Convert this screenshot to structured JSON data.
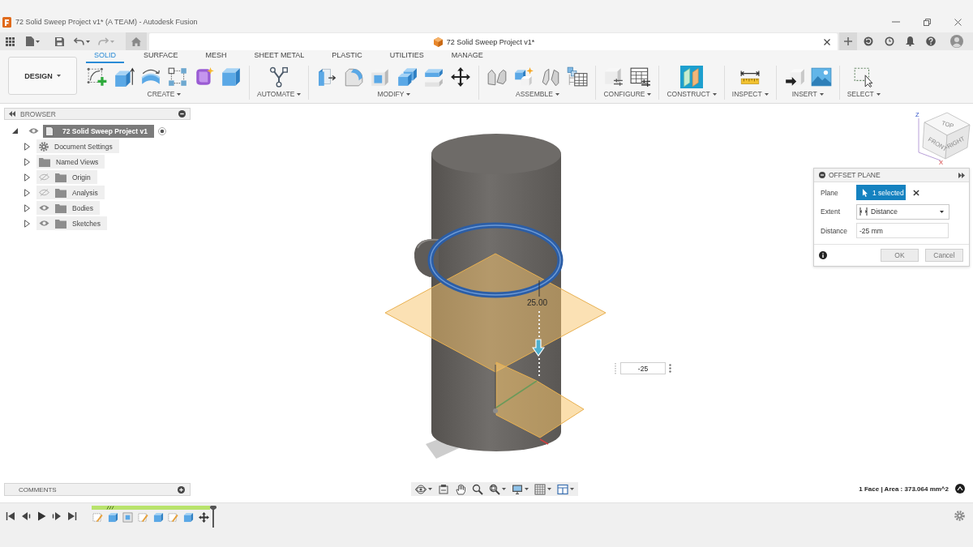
{
  "window": {
    "title": "72 Solid Sweep Project v1* (A TEAM) - Autodesk Fusion"
  },
  "document_tab": {
    "title": "72 Solid Sweep Project v1*"
  },
  "ribbon": {
    "workspace": "DESIGN",
    "tabs": [
      {
        "label": "SOLID",
        "selected": true
      },
      {
        "label": "SURFACE",
        "selected": false
      },
      {
        "label": "MESH",
        "selected": false
      },
      {
        "label": "SHEET METAL",
        "selected": false
      },
      {
        "label": "PLASTIC",
        "selected": false
      },
      {
        "label": "UTILITIES",
        "selected": false
      },
      {
        "label": "MANAGE",
        "selected": false
      }
    ],
    "groups": [
      {
        "label": "CREATE"
      },
      {
        "label": "AUTOMATE"
      },
      {
        "label": "MODIFY"
      },
      {
        "label": "ASSEMBLE"
      },
      {
        "label": "CONFIGURE"
      },
      {
        "label": "CONSTRUCT"
      },
      {
        "label": "INSPECT"
      },
      {
        "label": "INSERT"
      },
      {
        "label": "SELECT"
      }
    ]
  },
  "browser": {
    "title": "BROWSER",
    "root": {
      "label": "72 Solid Sweep Project v1",
      "selected": true,
      "expanded": true,
      "visible": true,
      "children": [
        {
          "label": "Document Settings",
          "kind": "settings",
          "selected": false,
          "expanded": false
        },
        {
          "label": "Named Views",
          "kind": "folder",
          "selected": false,
          "expanded": false
        },
        {
          "label": "Origin",
          "kind": "folder",
          "visible": false,
          "selected": false,
          "expanded": false
        },
        {
          "label": "Analysis",
          "kind": "folder",
          "visible": false,
          "selected": false,
          "expanded": false
        },
        {
          "label": "Bodies",
          "kind": "folder",
          "visible": true,
          "selected": false,
          "expanded": false
        },
        {
          "label": "Sketches",
          "kind": "folder",
          "visible": true,
          "selected": false,
          "expanded": false
        }
      ]
    }
  },
  "viewcube": {
    "faces": [
      "TOP",
      "FRONT",
      "RIGHT"
    ],
    "axes": [
      "Z",
      "X"
    ]
  },
  "viewport": {
    "dimension": "25.00",
    "distance_value": "-25"
  },
  "offset_plane": {
    "title": "OFFSET PLANE",
    "rows": [
      {
        "label": "Plane",
        "kind": "selection",
        "value": "1 selected"
      },
      {
        "label": "Extent",
        "kind": "dropdown",
        "value": "Distance"
      },
      {
        "label": "Distance",
        "kind": "input",
        "value": "-25 mm"
      }
    ],
    "buttons": [
      {
        "label": "OK"
      },
      {
        "label": "Cancel"
      }
    ]
  },
  "comments": {
    "title": "COMMENTS"
  },
  "status_bar": {
    "selection_info": "1 Face | Area : 373.064 mm^2"
  }
}
